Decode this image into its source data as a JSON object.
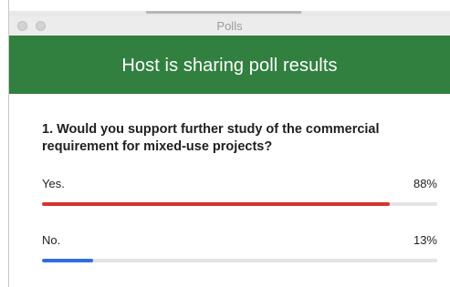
{
  "window": {
    "title": "Polls"
  },
  "banner": {
    "text": "Host is sharing poll results",
    "color": "#31803f"
  },
  "poll": {
    "question": "1. Would you support further study of the commercial requirement for mixed-use projects?",
    "options": [
      {
        "label": "Yes.",
        "percent_label": "88%",
        "percent": 88,
        "color": "#d8312f"
      },
      {
        "label": "No.",
        "percent_label": "13%",
        "percent": 13,
        "color": "#2f6fdb"
      }
    ]
  }
}
